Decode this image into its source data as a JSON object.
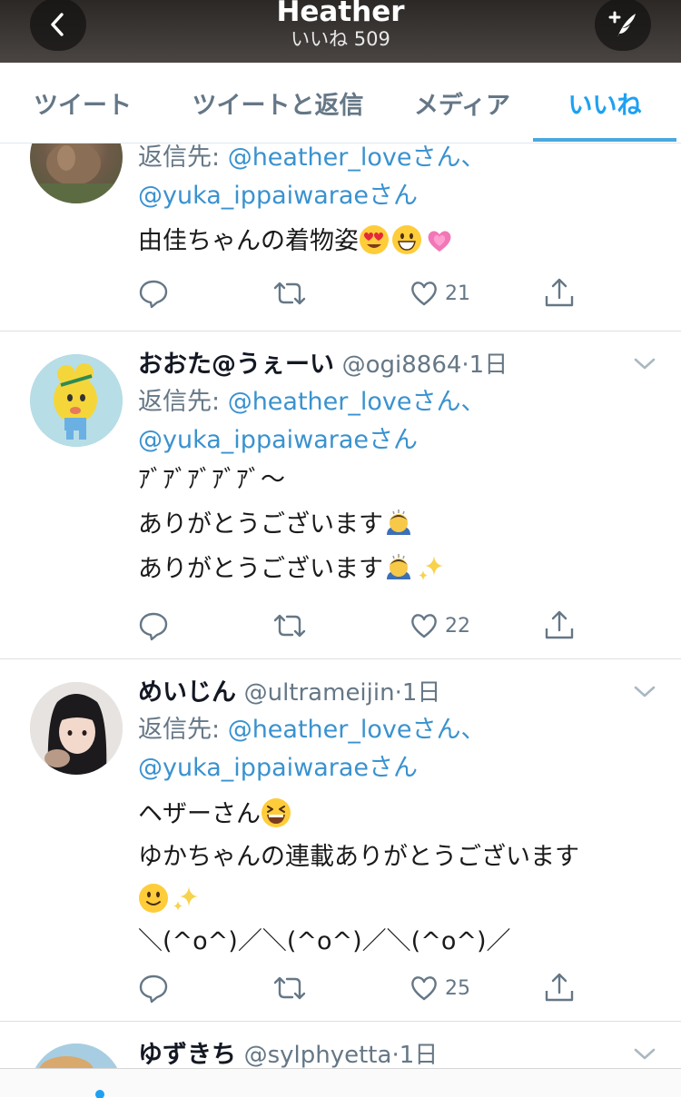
{
  "header": {
    "title": "Heather",
    "likes_count_label": "いいね 509",
    "back_icon": "chevron-left-icon",
    "compose_icon": "compose-icon"
  },
  "tabs": [
    {
      "label": "ツイート",
      "active": false
    },
    {
      "label": "ツイートと返信",
      "active": false
    },
    {
      "label": "メディア",
      "active": false
    },
    {
      "label": "いいね",
      "active": true
    }
  ],
  "colors": {
    "accent": "#1da1f2",
    "mention": "#3a92cf",
    "secondary_text": "#657786"
  },
  "tweets": [
    {
      "reply_prefix": "返信先: ",
      "reply_mention_1": "@heather_loveさん、",
      "reply_mention_2": "@yuka_ippaiwaraeさん",
      "lines": [
        "由佳ちゃんの着物姿"
      ],
      "emojis": [
        "heart-eyes-emoji",
        "grinning-emoji",
        "growing-heart-emoji"
      ],
      "likes": "21"
    },
    {
      "name": "おおた@うぇーい",
      "handle": "@ogi8864",
      "time": "·1日",
      "reply_prefix": "返信先: ",
      "reply_mention_1": "@heather_loveさん、",
      "reply_mention_2": "@yuka_ippaiwaraeさん",
      "lines": [
        "ｱﾞｱﾞｱﾞｱﾞｱﾞ～",
        "ありがとうございます",
        "ありがとうございます"
      ],
      "emojis": [
        "bowing-person-emoji",
        "bowing-person-emoji",
        "sparkles-emoji"
      ],
      "likes": "22"
    },
    {
      "name": "めいじん",
      "handle": "@ultrameijin",
      "time": "·1日",
      "reply_prefix": "返信先: ",
      "reply_mention_1": "@heather_loveさん、",
      "reply_mention_2": "@yuka_ippaiwaraeさん",
      "lines": [
        "ヘザーさん",
        "ゆかちゃんの連載ありがとうございます",
        "＼(^o^)／＼(^o^)／＼(^o^)／"
      ],
      "emojis": [
        "laughing-emoji",
        "slightly-smiling-emoji",
        "sparkles-emoji"
      ],
      "likes": "25"
    },
    {
      "name": "ゆずきち",
      "handle": "@sylphyetta",
      "time": "·1日"
    }
  ]
}
